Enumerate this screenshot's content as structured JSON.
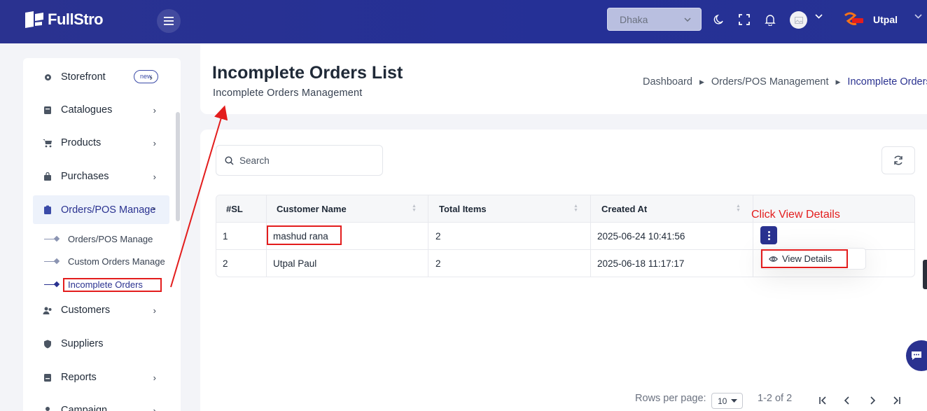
{
  "app": {
    "brand": "FullStro",
    "user_name": "Utpal"
  },
  "topbar": {
    "branch": "Dhaka",
    "icons": [
      "moon-icon",
      "fullscreen-icon",
      "bell-icon",
      "avatar",
      "chevron-down-icon"
    ]
  },
  "sidebar": {
    "items": [
      {
        "label": "Storefront",
        "badge": "new"
      },
      {
        "label": "Catalogues"
      },
      {
        "label": "Products"
      },
      {
        "label": "Purchases"
      },
      {
        "label": "Orders/POS Manage"
      },
      {
        "label": "Customers"
      },
      {
        "label": "Suppliers"
      },
      {
        "label": "Reports"
      },
      {
        "label": "Campaign"
      }
    ],
    "sub_items": [
      {
        "label": "Orders/POS Manage"
      },
      {
        "label": "Custom Orders Manage"
      },
      {
        "label": "Incomplete Orders"
      }
    ]
  },
  "page": {
    "title": "Incomplete Orders List",
    "subtitle": "Incomplete Orders Management",
    "breadcrumb": [
      "Dashboard",
      "Orders/POS Management",
      "Incomplete Orders"
    ]
  },
  "search": {
    "placeholder": "Search"
  },
  "table": {
    "headers": [
      "#SL",
      "Customer Name",
      "Total Items",
      "Created At"
    ],
    "rows": [
      {
        "sl": "1",
        "name": "mashud rana",
        "items": "2",
        "created": "2025-06-24 10:41:56"
      },
      {
        "sl": "2",
        "name": "Utpal Paul",
        "items": "2",
        "created": "2025-06-18 11:17:17"
      }
    ]
  },
  "menu": {
    "view_details": "View Details"
  },
  "annotation": {
    "text": "Click View Details"
  },
  "pagination": {
    "rows_label": "Rows per page:",
    "rows_value": "10",
    "range": "1-2 of 2"
  },
  "colors": {
    "primary": "#2a3290",
    "annotation": "#e31d1d"
  }
}
